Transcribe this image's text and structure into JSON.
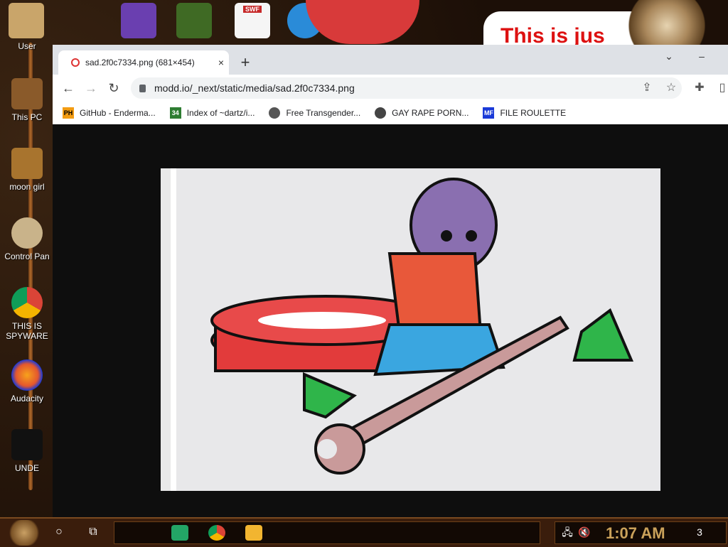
{
  "desktop": {
    "icons": [
      {
        "label": "User"
      },
      {
        "label": "This PC"
      },
      {
        "label": "moon girl"
      },
      {
        "label": "Control Pan"
      },
      {
        "label": "THIS IS SPYWARE"
      },
      {
        "label": "Audacity"
      },
      {
        "label": "UNDE"
      }
    ],
    "top_icons": [
      {
        "icon": "visual-studio-icon",
        "color": "#7b4fc9"
      },
      {
        "icon": "minecraft-icon",
        "color": "#4a6b2a"
      },
      {
        "icon": "flash-swf-icon",
        "color": "#c62828",
        "text": "SWF"
      },
      {
        "icon": "p-app-icon",
        "color": "#2a8bd8"
      }
    ],
    "banner_text": "This is jus"
  },
  "browser": {
    "tab": {
      "title": "sad.2f0c7334.png (681×454)",
      "close": "×"
    },
    "new_tab": "+",
    "controls": {
      "chevron": "⌄",
      "minimize": "–"
    },
    "nav": {
      "back": "←",
      "forward": "→",
      "reload": "↻"
    },
    "url": "modd.io/_next/static/media/sad.2f0c7334.png",
    "bookmarks": [
      {
        "label": "GitHub - Enderma...",
        "icon": "PH",
        "color": "#f39c12"
      },
      {
        "label": "Index of ~dartz/i...",
        "icon": "34",
        "color": "#2e7d32"
      },
      {
        "label": "Free Transgender...",
        "icon": "",
        "color": "#555"
      },
      {
        "label": "GAY RAPE PORN...",
        "icon": "",
        "color": "#444"
      },
      {
        "label": "FILE ROULETTE",
        "icon": "MF",
        "color": "#1a3ad8"
      }
    ]
  },
  "taskbar": {
    "clock": "1:07 AM",
    "notification_count": "3",
    "apps": [
      {
        "icon": "sheets-icon",
        "color": "#23a566"
      },
      {
        "icon": "chrome-icon",
        "color": "#db4437"
      },
      {
        "icon": "file-explorer-icon",
        "color": "#f2b530"
      }
    ]
  }
}
